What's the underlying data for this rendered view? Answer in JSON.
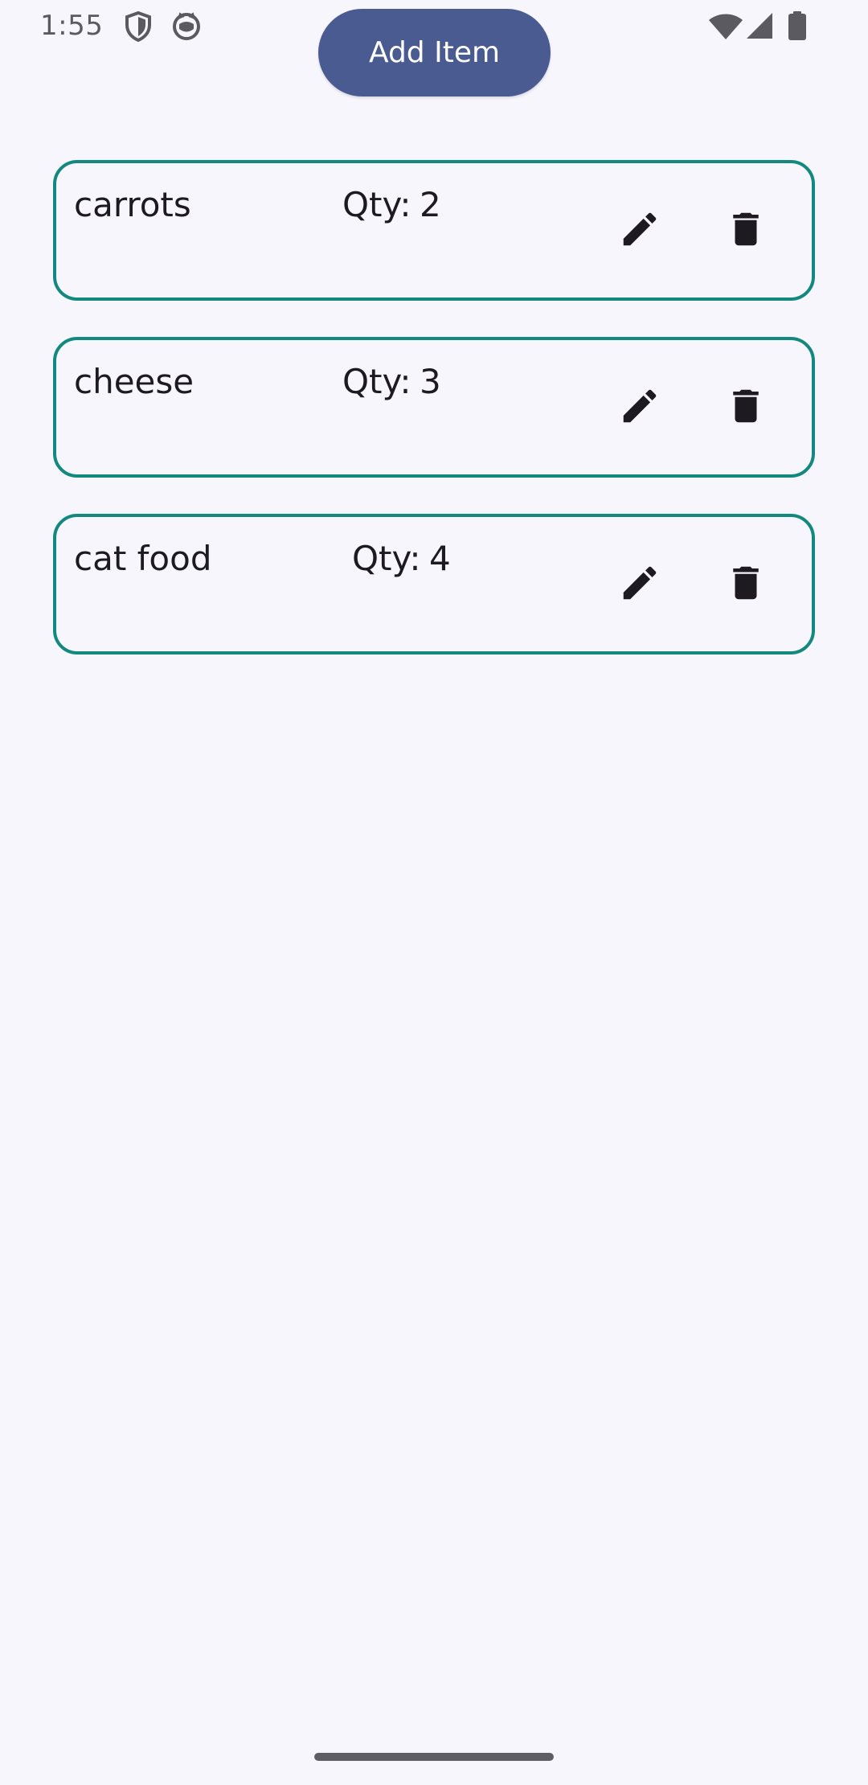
{
  "status_bar": {
    "time": "1:55",
    "left_icons": [
      "shield-icon",
      "cat-face-icon"
    ],
    "right_icons": [
      "wifi-icon",
      "cell-signal-icon",
      "battery-icon"
    ]
  },
  "header": {
    "add_button_label": "Add Item"
  },
  "items": [
    {
      "name": "carrots",
      "qty_label": "Qty:",
      "qty": "2"
    },
    {
      "name": "cheese",
      "qty_label": "Qty:",
      "qty": "3"
    },
    {
      "name": "cat food",
      "qty_label": "Qty:",
      "qty": "4"
    }
  ],
  "item_actions": {
    "edit_icon": "pencil-icon",
    "delete_icon": "trash-icon"
  },
  "colors": {
    "background": "#f7f6fc",
    "button": "#4a5b92",
    "card_border": "#13887f",
    "text": "#1d1b20"
  }
}
